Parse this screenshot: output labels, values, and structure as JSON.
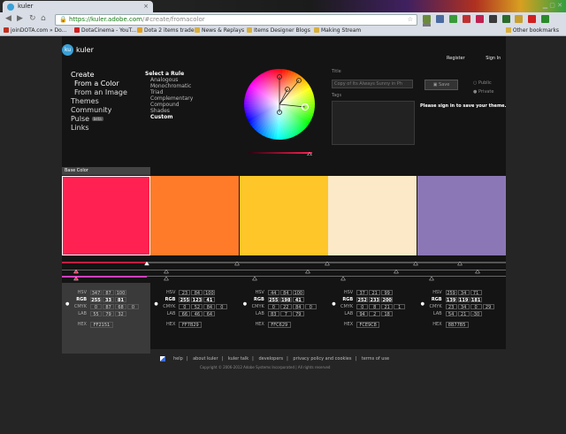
{
  "browser": {
    "tab_title": "kuler",
    "url_scheme": "https://",
    "url_host": "kuler.adobe.com",
    "url_path": "/#create/fromacolor",
    "bookmarks": [
      {
        "label": "joinDOTA.com » Do...",
        "color": "#c03020"
      },
      {
        "label": "DotaCinema - YouT...",
        "color": "#d02020"
      },
      {
        "label": "Dota 2 items trade",
        "color": "#e0a020"
      },
      {
        "label": "News & Replays",
        "color": "#d8b040"
      },
      {
        "label": "Items Designer Blogs",
        "color": "#d8b040"
      },
      {
        "label": "Making Stream",
        "color": "#d8b040"
      }
    ],
    "other_bookmarks": "Other bookmarks"
  },
  "site": {
    "brand": "kuler",
    "register": "Register",
    "sign_in": "Sign In"
  },
  "nav": {
    "create": "Create",
    "from_color": "From a Color",
    "from_image": "From an Image",
    "themes": "Themes",
    "community": "Community",
    "pulse": "Pulse",
    "beta": "beta",
    "links": "Links"
  },
  "rules": {
    "header": "Select a Rule",
    "items": [
      "Analogous",
      "Monochromatic",
      "Triad",
      "Complementary",
      "Compound",
      "Shades"
    ],
    "selected": "Custom"
  },
  "theme_form": {
    "title_label": "Title",
    "title_value": "Copy of Its Always Sunny in Ph",
    "save_label": "Save",
    "public_label": "Public",
    "private_label": "Private",
    "tags_label": "Tags",
    "signin_message": "Please sign in to save your theme."
  },
  "base_color_label": "Base Color",
  "labels": {
    "hsv": "HSV",
    "rgb": "RGB",
    "cmyk": "CMYK",
    "lab": "LAB",
    "hex": "HEX"
  },
  "colors": [
    {
      "hex_color": "#FF2151",
      "hsv": [
        "347",
        "87",
        "100"
      ],
      "rgb": [
        "255",
        "33",
        "81"
      ],
      "cmyk": [
        "0",
        "87",
        "68",
        "0"
      ],
      "lab": [
        "55",
        "79",
        "32"
      ],
      "hex": "FF2151"
    },
    {
      "hex_color": "#FF7B29",
      "hsv": [
        "23",
        "84",
        "100"
      ],
      "rgb": [
        "255",
        "123",
        "41"
      ],
      "cmyk": [
        "0",
        "52",
        "84",
        "0"
      ],
      "lab": [
        "66",
        "46",
        "64"
      ],
      "hex": "FF7B29"
    },
    {
      "hex_color": "#FFC629",
      "hsv": [
        "44",
        "84",
        "100"
      ],
      "rgb": [
        "255",
        "198",
        "41"
      ],
      "cmyk": [
        "0",
        "22",
        "84",
        "0"
      ],
      "lab": [
        "83",
        "7",
        "79"
      ],
      "hex": "FFC629"
    },
    {
      "hex_color": "#FCE9C8",
      "hsv": [
        "37",
        "21",
        "99"
      ],
      "rgb": [
        "252",
        "233",
        "200"
      ],
      "cmyk": [
        "0",
        "8",
        "21",
        "1"
      ],
      "lab": [
        "94",
        "2",
        "18"
      ],
      "hex": "FCE9C8"
    },
    {
      "hex_color": "#8B77B5",
      "hsv": [
        "259",
        "34",
        "71"
      ],
      "rgb": [
        "139",
        "119",
        "181"
      ],
      "cmyk": [
        "23",
        "34",
        "0",
        "29"
      ],
      "lab": [
        "54",
        "21",
        "-30"
      ],
      "hex": "8B77B5"
    }
  ],
  "footer": {
    "links": [
      "help",
      "about kuler",
      "kuler talk",
      "developers",
      "privacy policy and cookies",
      "terms of use"
    ],
    "copyright": "Copyright © 2006-2012 Adobe Systems Incorporated | All rights reserved"
  },
  "accent": "#3aa0d8"
}
